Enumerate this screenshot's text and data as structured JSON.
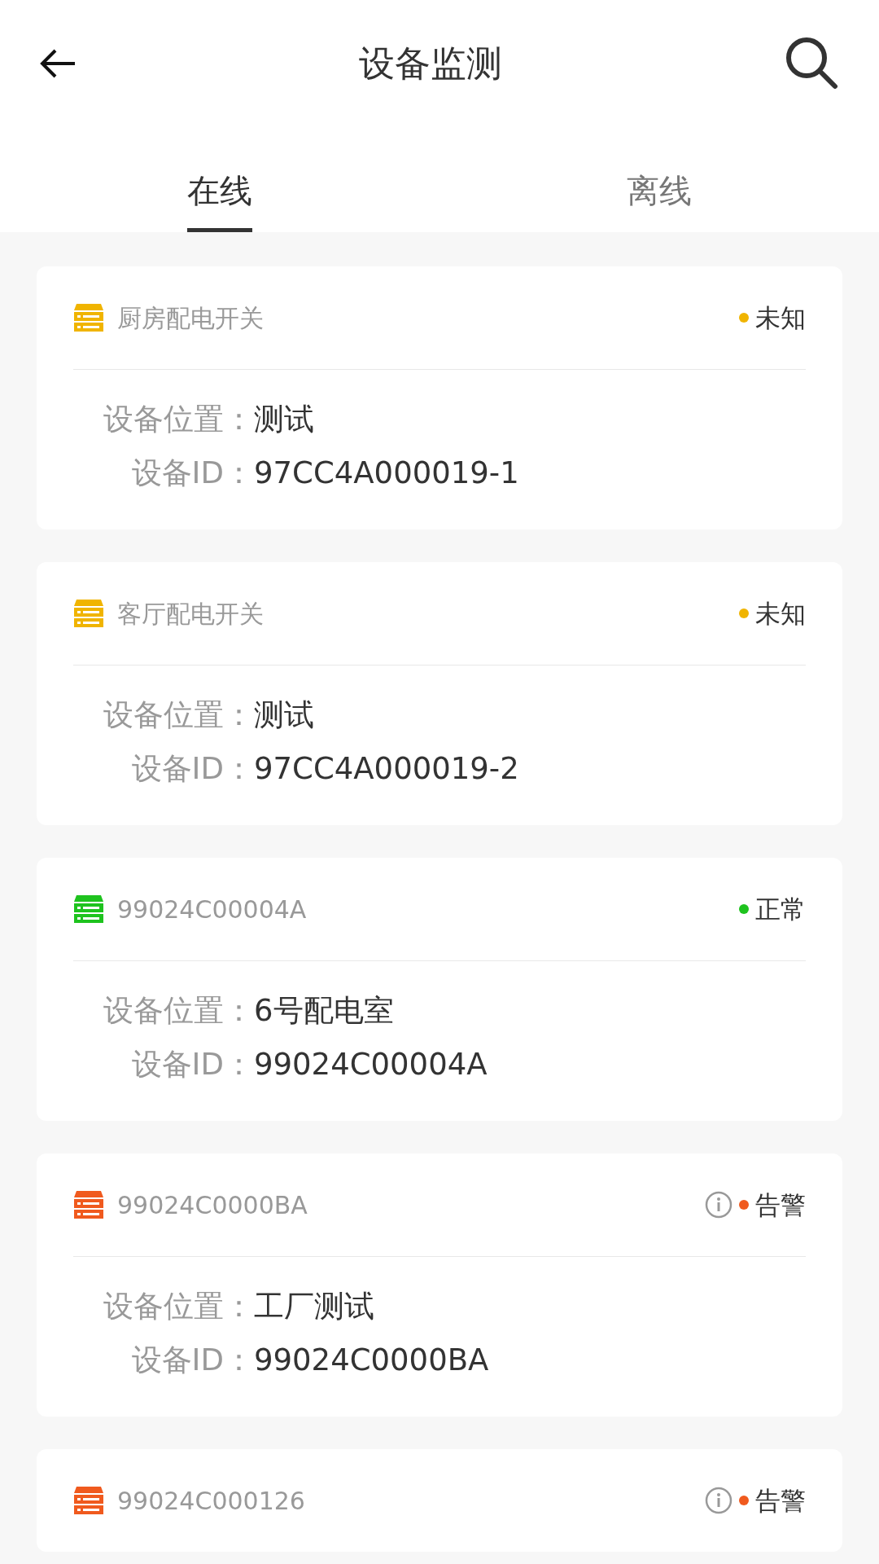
{
  "header": {
    "title": "设备监测"
  },
  "tabs": [
    {
      "label": "在线",
      "selected": true
    },
    {
      "label": "离线",
      "selected": false
    }
  ],
  "devices": [
    {
      "name": "厨房配电开关",
      "status": "未知",
      "color": "#f0b400",
      "info": false,
      "location_label": "设备位置：",
      "location": "测试",
      "id_label": "设备ID：",
      "id": "97CC4A000019-1"
    },
    {
      "name": "客厅配电开关",
      "status": "未知",
      "color": "#f0b400",
      "info": false,
      "location_label": "设备位置：",
      "location": "测试",
      "id_label": "设备ID：",
      "id": "97CC4A000019-2"
    },
    {
      "name": "99024C00004A",
      "status": "正常",
      "color": "#1ec31e",
      "info": false,
      "location_label": "设备位置：",
      "location": "6号配电室",
      "id_label": "设备ID：",
      "id": "99024C00004A"
    },
    {
      "name": "99024C0000BA",
      "status": "告警",
      "color": "#f05a1e",
      "info": true,
      "location_label": "设备位置：",
      "location": "工厂测试",
      "id_label": "设备ID：",
      "id": "99024C0000BA"
    },
    {
      "name": "99024C000126",
      "status": "告警",
      "color": "#f05a1e",
      "info": true
    }
  ]
}
